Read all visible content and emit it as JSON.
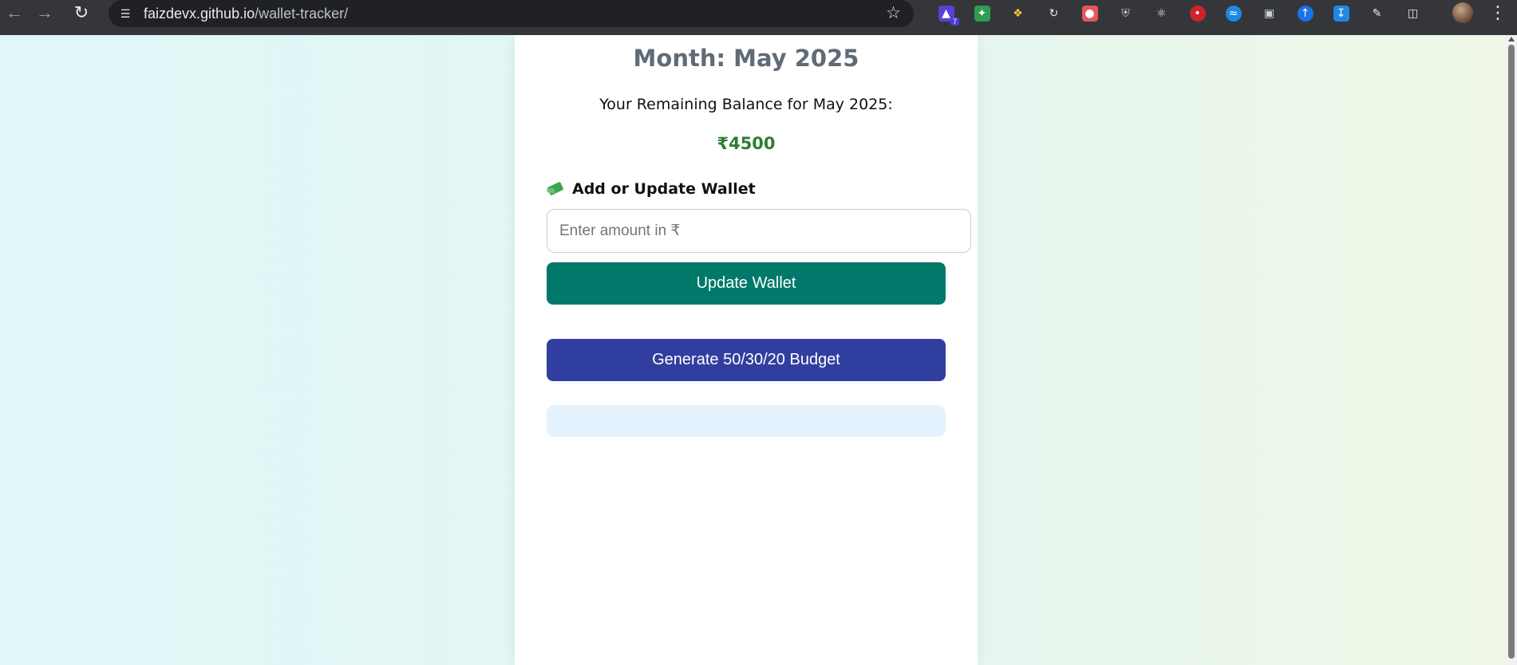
{
  "browser": {
    "url_host": "faizdevx.github.io",
    "url_path": "/wallet-tracker/",
    "extension_badge": "7",
    "colors": {
      "toolbar": "#35363a",
      "omnibox": "#202124"
    }
  },
  "page": {
    "month_title": "Month: May 2025",
    "balance_label": "Your Remaining Balance for May 2025:",
    "balance_amount": "₹4500",
    "wallet_section": {
      "icon": "money-with-wings-icon",
      "heading": "Add or Update Wallet",
      "input_placeholder": "Enter amount in ₹",
      "input_value": ""
    },
    "update_button_label": "Update Wallet",
    "budget_button_label": "Generate 50/30/20 Budget",
    "colors": {
      "title": "#5f6b77",
      "balance_amount": "#2e7d32",
      "update_button": "#00796b",
      "budget_button": "#303f9f",
      "budget_output_bg": "#e3f2fd"
    }
  }
}
